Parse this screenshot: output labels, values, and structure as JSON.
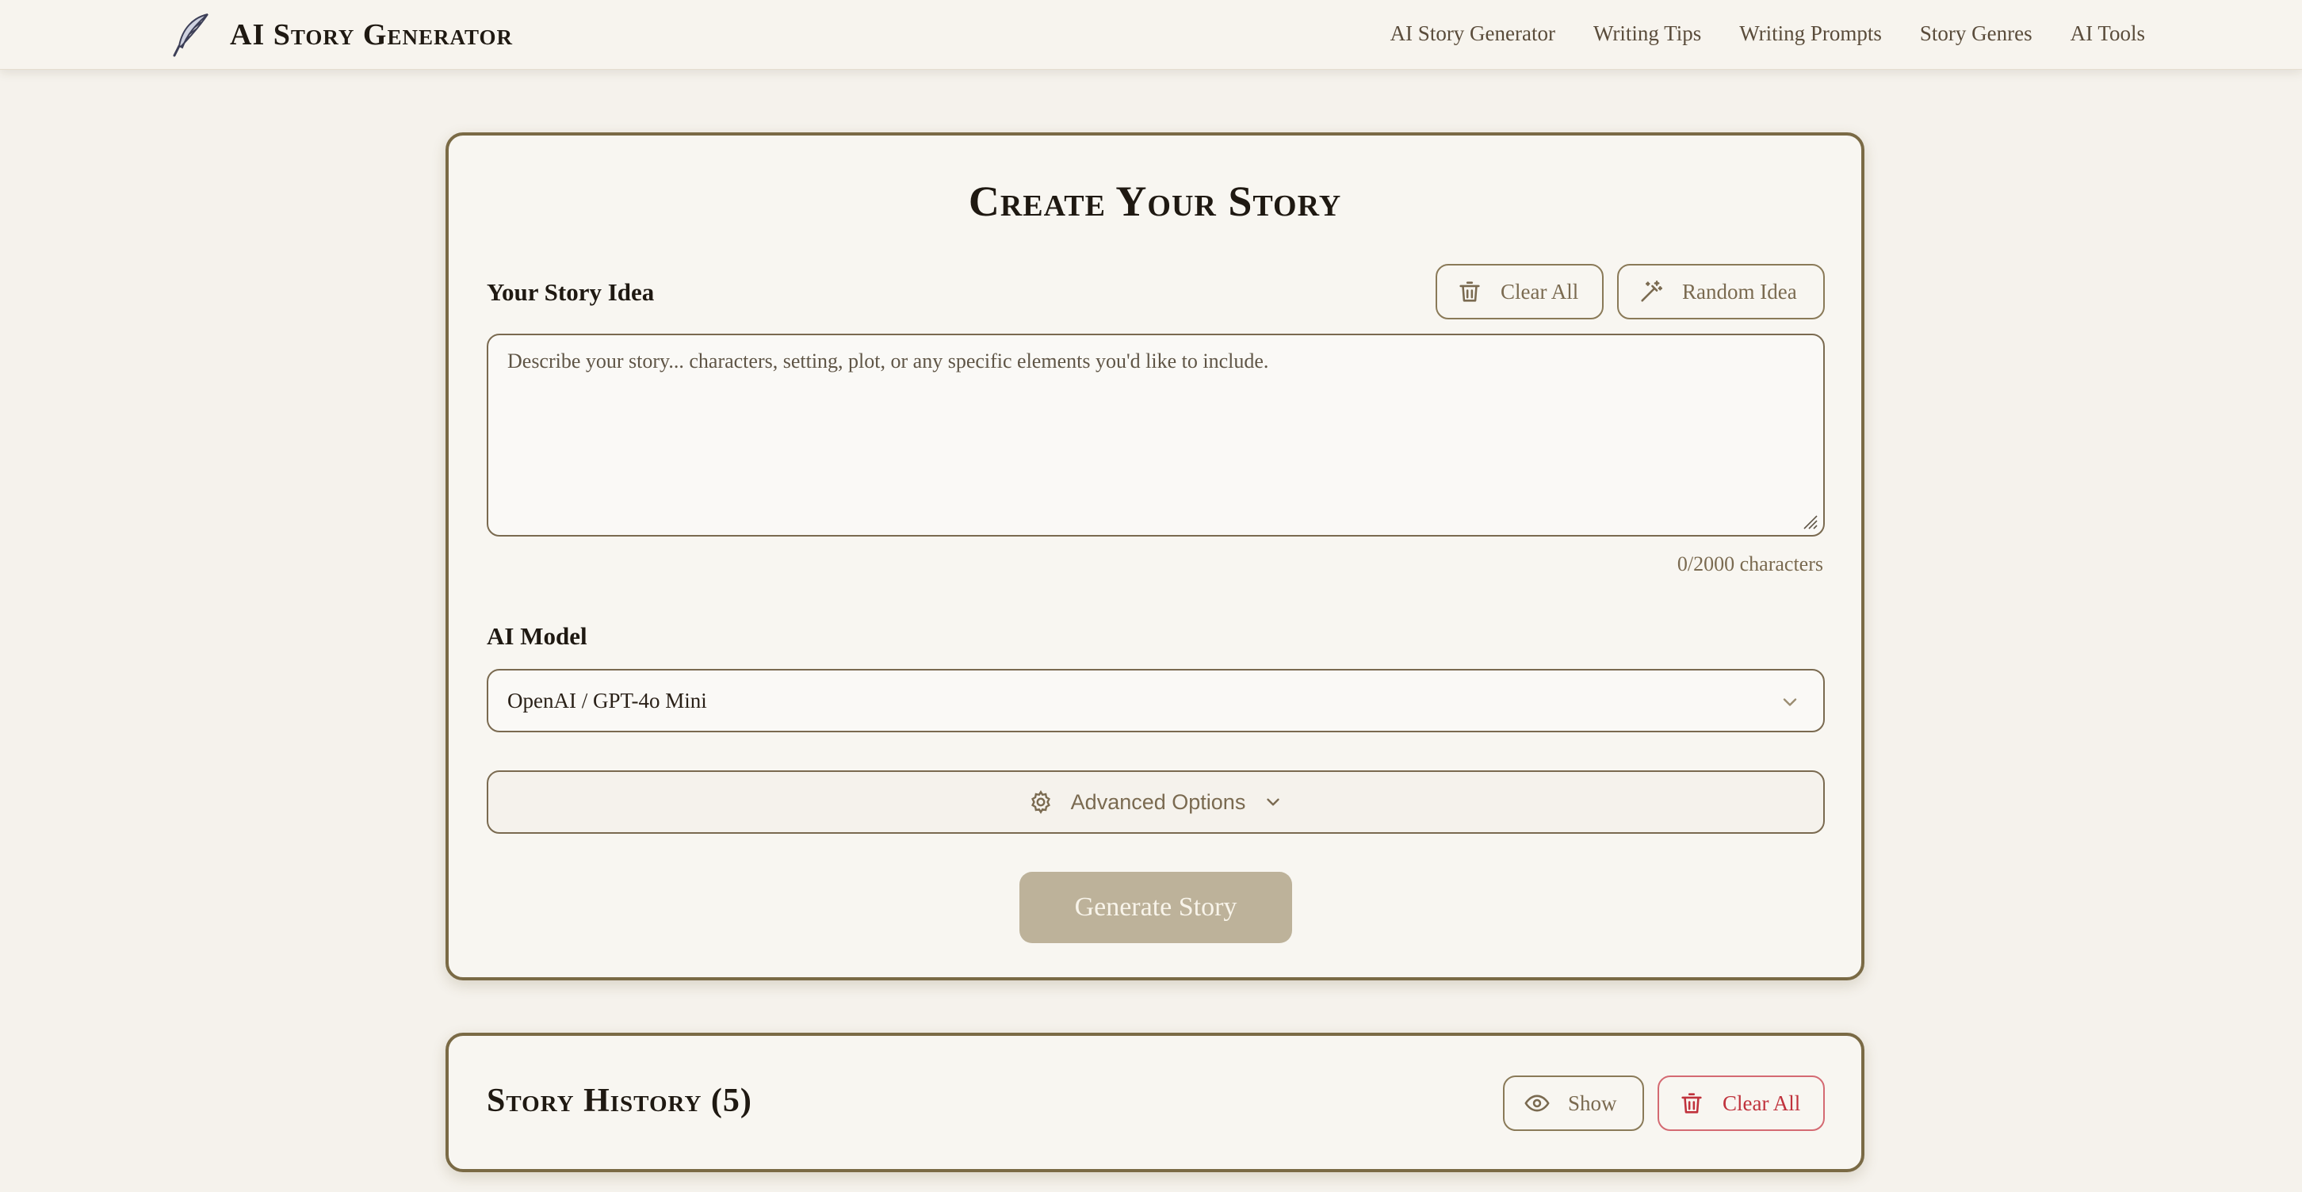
{
  "app": {
    "title": "AI Story Generator",
    "logo_icon": "quill-icon"
  },
  "nav": {
    "items": [
      {
        "label": "AI Story Generator"
      },
      {
        "label": "Writing Tips"
      },
      {
        "label": "Writing Prompts"
      },
      {
        "label": "Story Genres"
      },
      {
        "label": "AI Tools"
      }
    ]
  },
  "create": {
    "title": "Create Your Story",
    "idea_label": "Your Story Idea",
    "clear_all_label": "Clear All",
    "clear_all_icon": "trash-icon",
    "random_idea_label": "Random Idea",
    "random_idea_icon": "magic-wand-icon",
    "idea_placeholder": "Describe your story... characters, setting, plot, or any specific elements you'd like to include.",
    "idea_value": "",
    "char_count": "0/2000 characters",
    "model_label": "AI Model",
    "model_selected": "OpenAI / GPT-4o Mini",
    "advanced_label": "Advanced Options",
    "advanced_icon": "gear-icon",
    "generate_label": "Generate Story"
  },
  "history": {
    "title": "Story History (5)",
    "show_label": "Show",
    "show_icon": "eye-icon",
    "clear_all_label": "Clear All",
    "clear_all_icon": "trash-icon"
  },
  "colors": {
    "accent": "#7a6a45",
    "button_disabled": "#bdb29a",
    "danger": "#c0323c",
    "background": "#f5f2ec"
  }
}
